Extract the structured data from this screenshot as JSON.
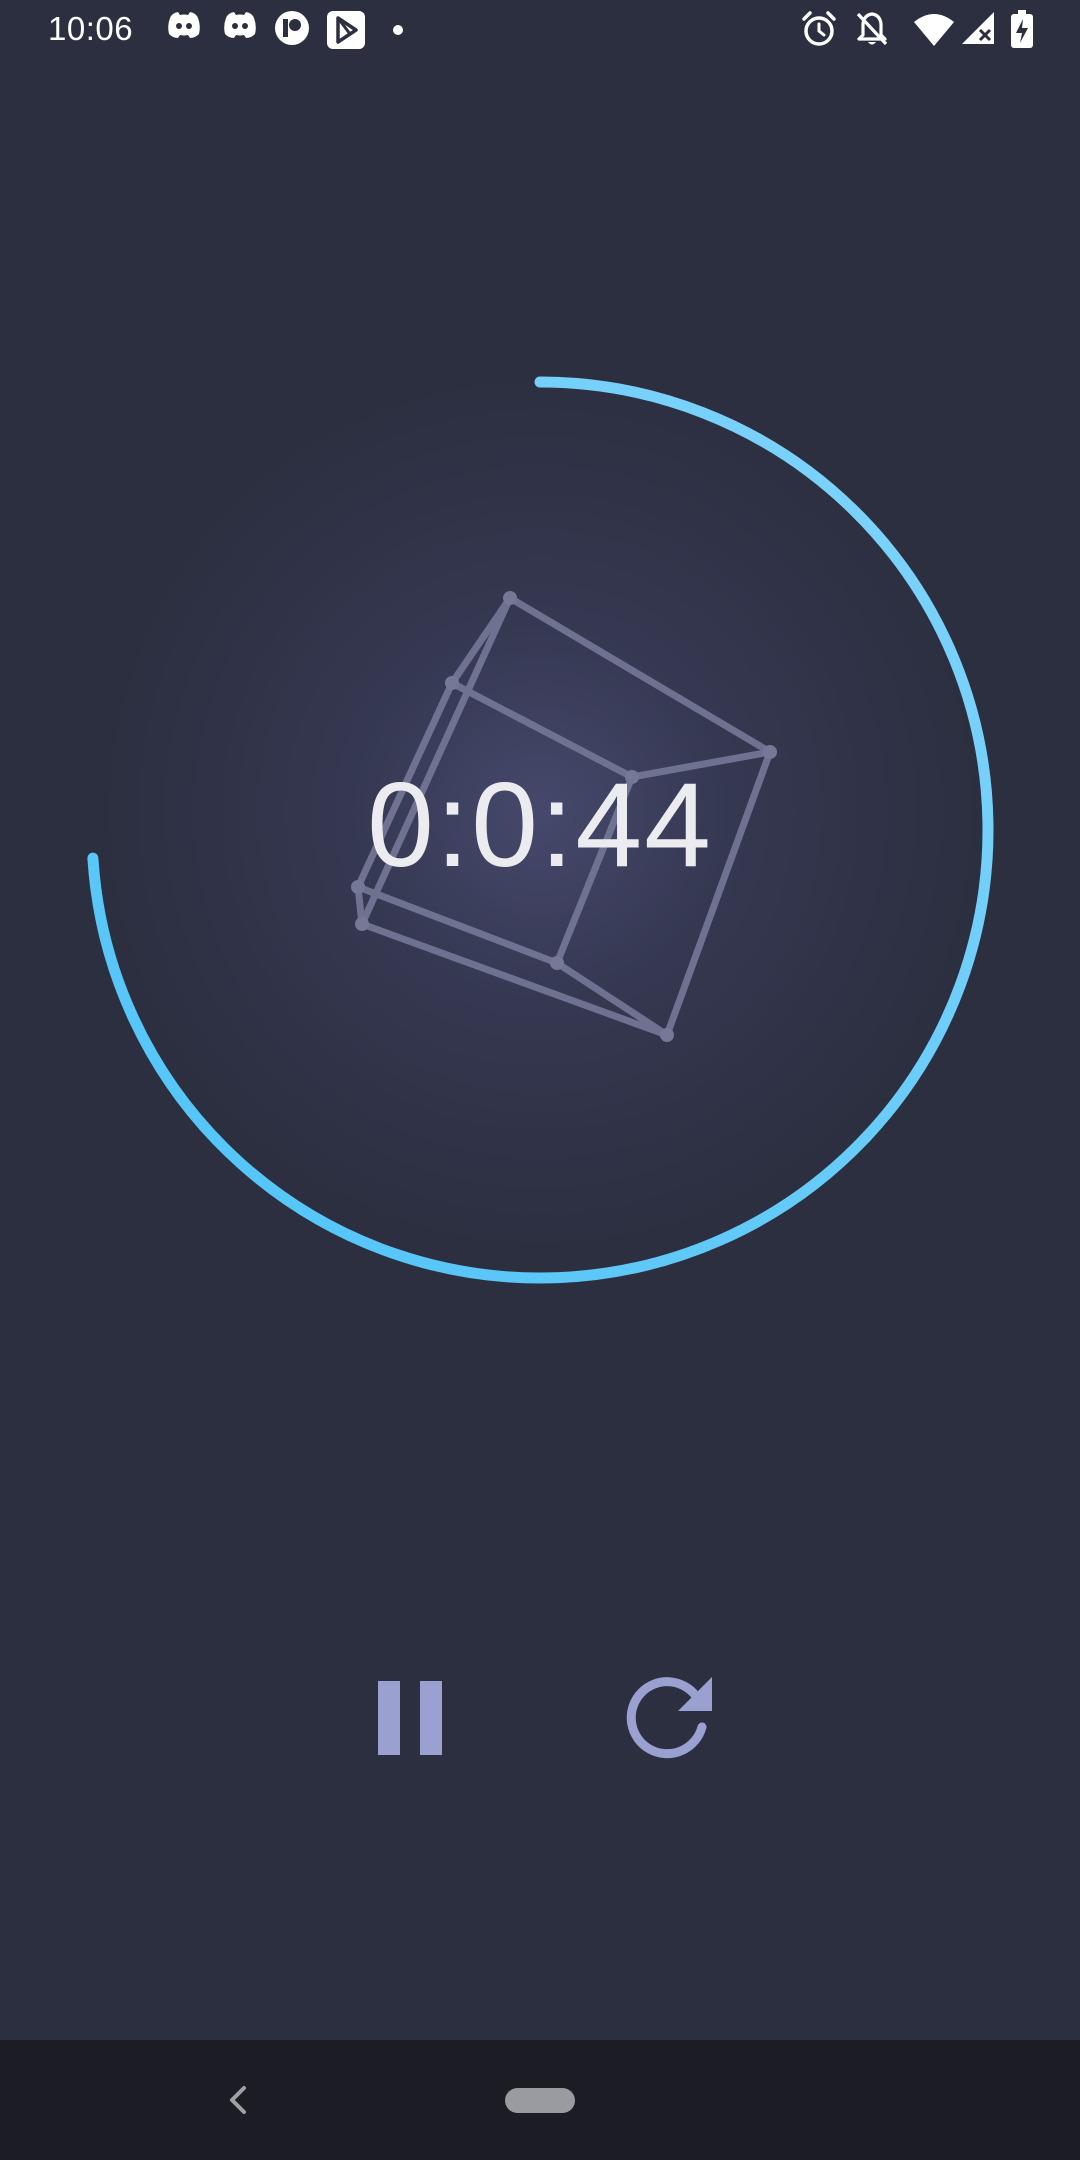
{
  "status_bar": {
    "time": "10:06",
    "left_icons": [
      "discord-icon",
      "discord-icon",
      "patreon-icon",
      "play-store-icon",
      "notification-dot-icon"
    ],
    "right_icons": [
      "alarm-icon",
      "notifications-off-icon",
      "wifi-icon",
      "signal-no-data-icon",
      "battery-charging-icon"
    ]
  },
  "timer": {
    "display": "0:0:44",
    "progress_fraction": 0.74,
    "ring_color_start": "#4fc3f7",
    "ring_color_end": "#81d4fa"
  },
  "controls": {
    "pause_icon": "pause-icon",
    "reset_icon": "restart-icon",
    "icon_color": "#9aa0d0"
  },
  "nav_bar": {
    "back_icon": "chevron-left-icon",
    "home_icon": "home-pill"
  }
}
